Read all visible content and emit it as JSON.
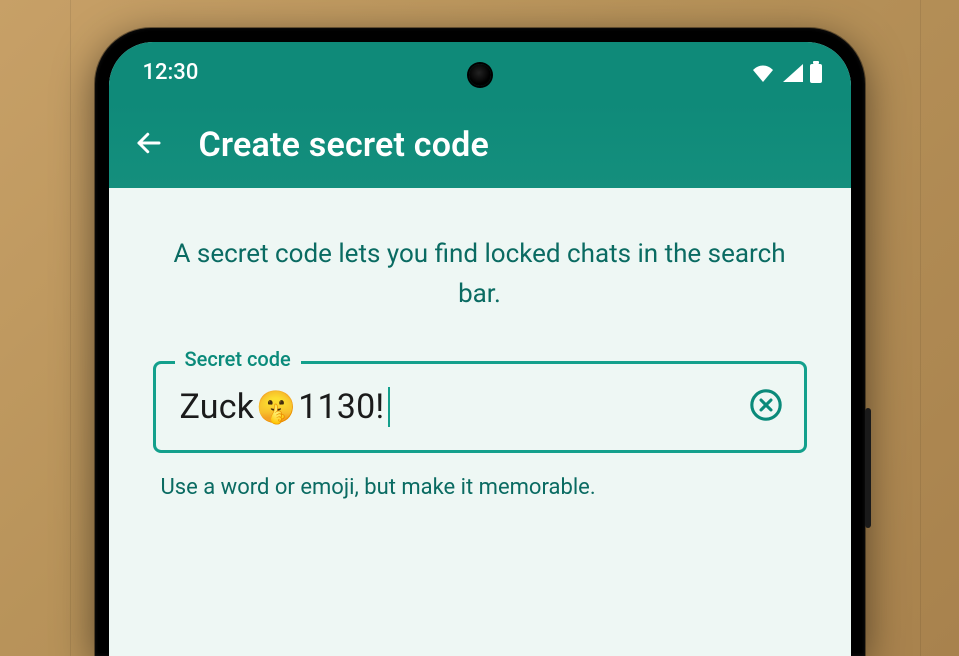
{
  "statusbar": {
    "time": "12:30"
  },
  "appbar": {
    "title": "Create secret code"
  },
  "content": {
    "description": "A secret code lets you find locked chats in the search bar.",
    "field_label": "Secret code",
    "field_value_prefix": "Zuck",
    "field_value_emoji": "🤫",
    "field_value_suffix": "1130!",
    "helper": "Use a word or emoji, but make it memorable."
  },
  "colors": {
    "brand_green": "#128C7E",
    "accent_teal": "#13a08c",
    "text_teal": "#0a6b62",
    "screen_bg": "#eef7f4"
  }
}
